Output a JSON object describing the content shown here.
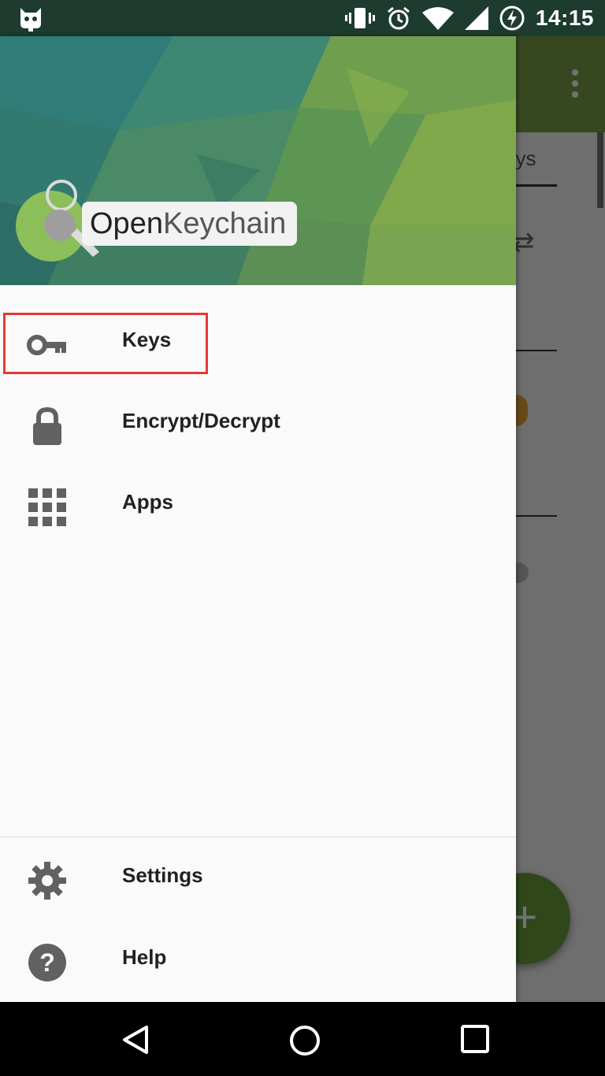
{
  "status_bar": {
    "time": "14:15",
    "icons": [
      "cyanogen-bot-icon",
      "vibrate-icon",
      "alarm-icon",
      "wifi-icon",
      "signal-icon",
      "battery-charging-icon"
    ]
  },
  "drawer": {
    "logo_text_bold": "Open",
    "logo_text_light": "Keychain",
    "items": [
      {
        "label": "Keys",
        "icon": "key-icon",
        "selected": true
      },
      {
        "label": "Encrypt/Decrypt",
        "icon": "lock-icon"
      },
      {
        "label": "Apps",
        "icon": "apps-grid-icon"
      }
    ],
    "footer_items": [
      {
        "label": "Settings",
        "icon": "gear-icon"
      },
      {
        "label": "Help",
        "icon": "help-icon"
      }
    ]
  },
  "background_app": {
    "tab_partial": "eys"
  },
  "colors": {
    "toolbar": "#7aa04b",
    "fab": "#6b9d3f",
    "highlight_border": "#e53935"
  }
}
